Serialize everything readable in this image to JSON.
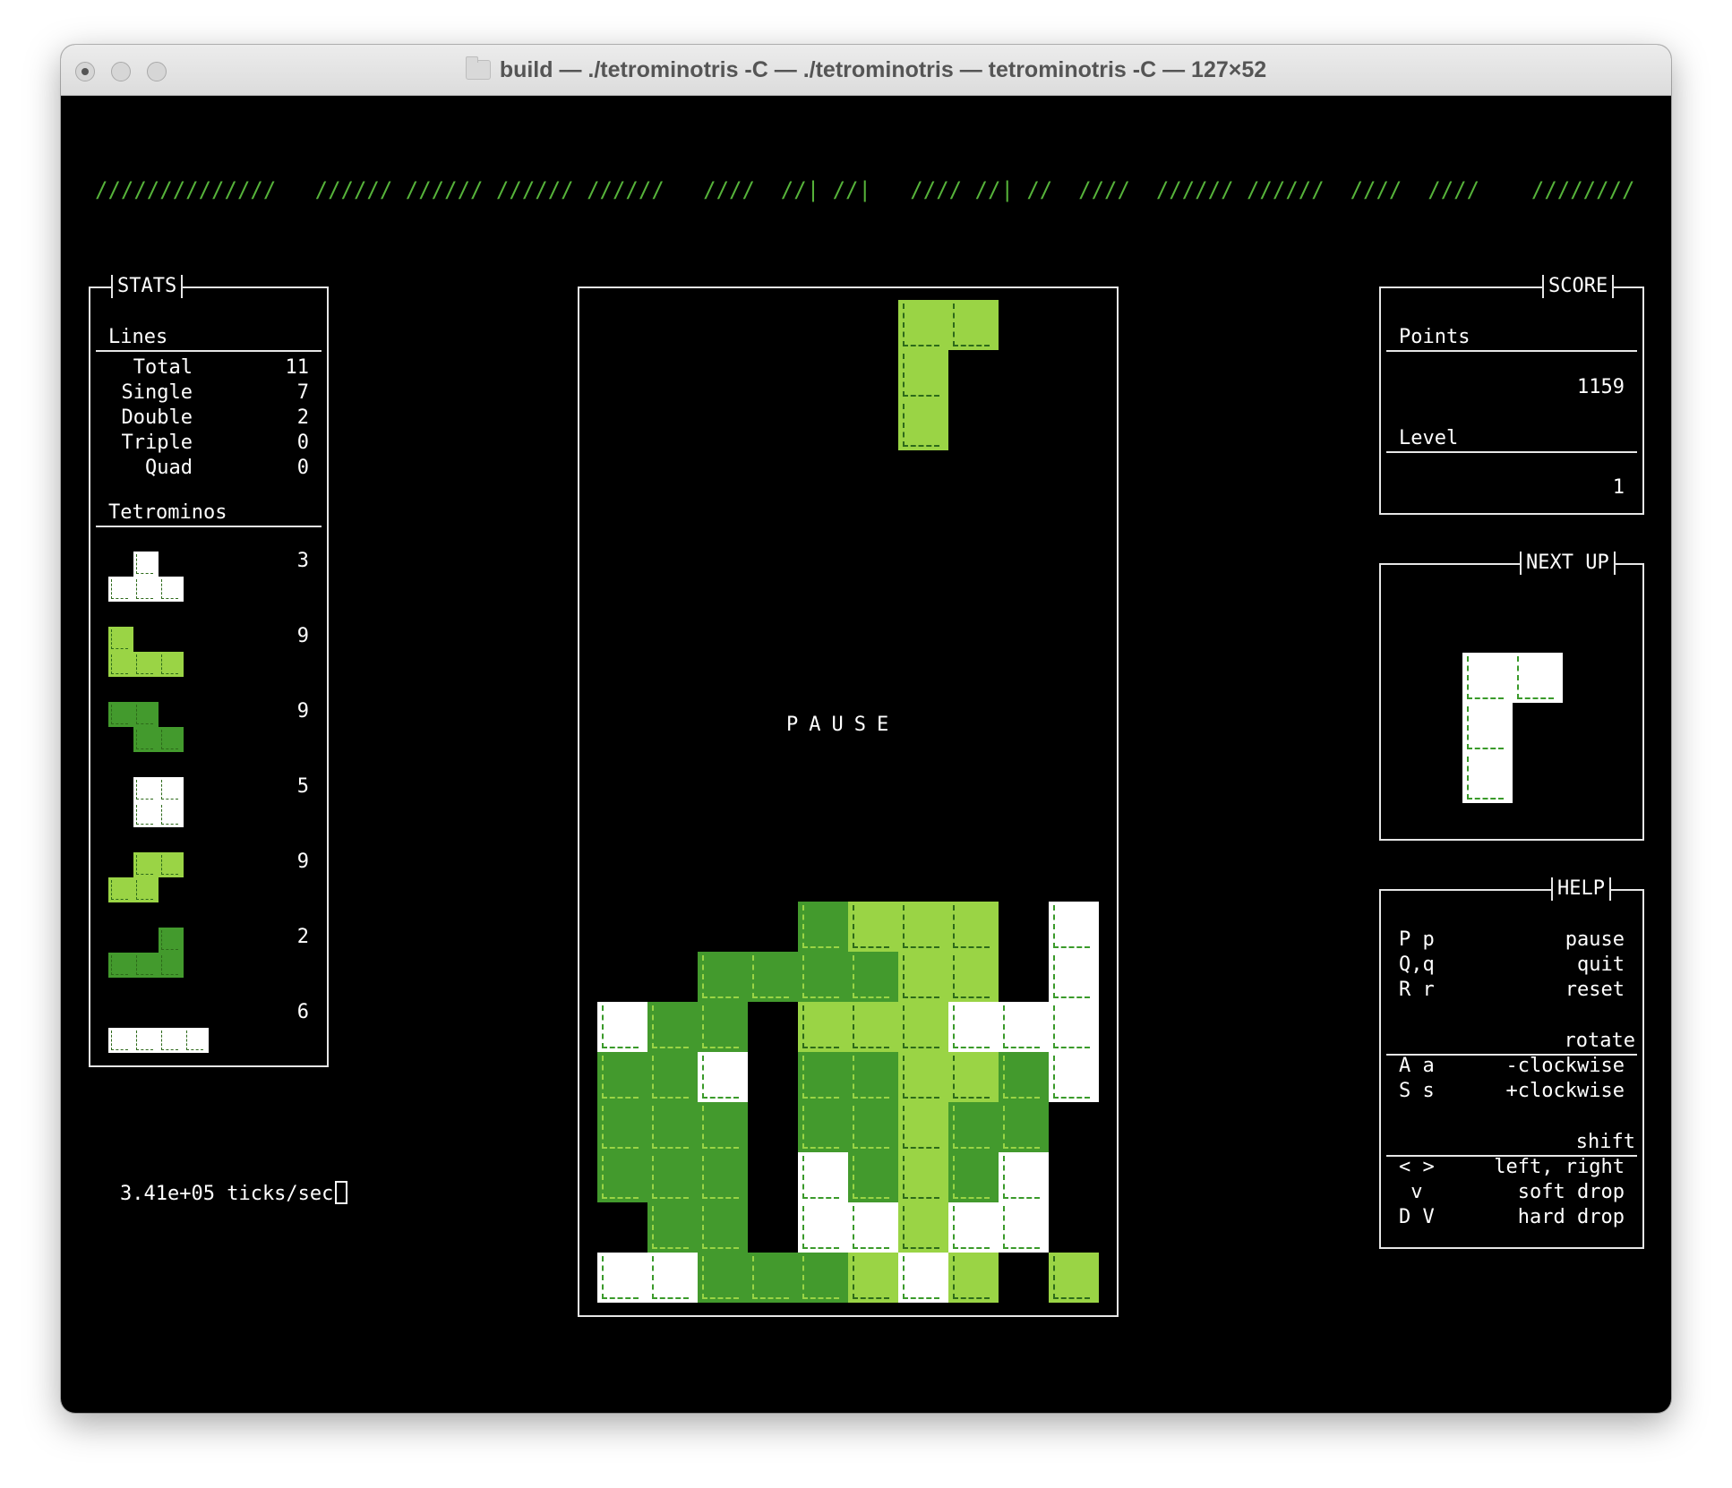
{
  "window": {
    "title": "build — ./tetrominotris -C — ./tetrominotris — tetrominotris -C — 127×52"
  },
  "banner": {
    "lines": [
      "//////////////   ////// ////// ////// //////   ////  //| //|   //// //| //  ////  ////// //////  ////  ////    //////////",
      "/////////////     //   //       //   //   // //  // //||//||  //  //||// //  //    //   //   // //  //        ///////////",
      "////////////     //   //////   //   //////  // //  // || //  //  // ||// //  //    //   //////  //   ///      ////////////",
      "///////////     //   //       //   //   ||  // //  //   //  //  //  // // //  //    //   //  ||  //     //    /////////////",
      "//////////     //   //////   //   //    ||  ////  //    // //// //  //  ////   //   //   || //// ////    //////////////"
    ]
  },
  "colors": {
    "white": "#ffffff",
    "light_green": "#9ad445",
    "dark_green": "#439a2d",
    "banner_green": "#56b33a"
  },
  "stats": {
    "title": "STATS",
    "lines_header": "Lines",
    "lines": [
      {
        "label": "Total",
        "value": "11"
      },
      {
        "label": "Single",
        "value": "7"
      },
      {
        "label": "Double",
        "value": "2"
      },
      {
        "label": "Triple",
        "value": "0"
      },
      {
        "label": "Quad",
        "value": "0"
      }
    ],
    "tetrominos_header": "Tetrominos",
    "tetrominos": [
      {
        "count": "3",
        "color": "white"
      },
      {
        "count": "9",
        "color": "light_green"
      },
      {
        "count": "9",
        "color": "dark_green"
      },
      {
        "count": "5",
        "color": "white"
      },
      {
        "count": "9",
        "color": "light_green"
      },
      {
        "count": "2",
        "color": "dark_green"
      },
      {
        "count": "6",
        "color": "white"
      }
    ]
  },
  "score": {
    "title": "SCORE",
    "points_label": "Points",
    "points_value": "1159",
    "level_label": "Level",
    "level_value": "1"
  },
  "next_up": {
    "title": "NEXT UP",
    "piece": "J",
    "color": "white"
  },
  "help": {
    "title": "HELP",
    "general": [
      {
        "key": "P p",
        "action": "pause"
      },
      {
        "key": "Q,q",
        "action": "quit"
      },
      {
        "key": "R r",
        "action": "reset"
      }
    ],
    "rotate_header": "rotate",
    "rotate": [
      {
        "key": "A a",
        "action": "-clockwise"
      },
      {
        "key": "S s",
        "action": "+clockwise"
      }
    ],
    "shift_header": "shift",
    "shift": [
      {
        "key": "< >",
        "action": "left, right"
      },
      {
        "key": " v",
        "action": "soft drop"
      },
      {
        "key": "D V",
        "action": "hard drop"
      }
    ]
  },
  "board": {
    "columns": 10,
    "rows": 20,
    "pause_text": "PAUSE",
    "falling_piece": {
      "color": "light_green",
      "cells": [
        [
          6,
          0
        ],
        [
          7,
          0
        ],
        [
          6,
          1
        ],
        [
          6,
          2
        ]
      ]
    },
    "stack": [
      "....DLLL.W",
      "..DDDDLL.W",
      "WDD.LLLWWW",
      "DDW.DDLLDW",
      "DDD.DDLDD.",
      "DDD.WDLDW.",
      ".DD.WWLWW.",
      "WWDDDLWL.L"
    ]
  },
  "status_bar": {
    "text": "3.41e+05 ticks/sec"
  }
}
